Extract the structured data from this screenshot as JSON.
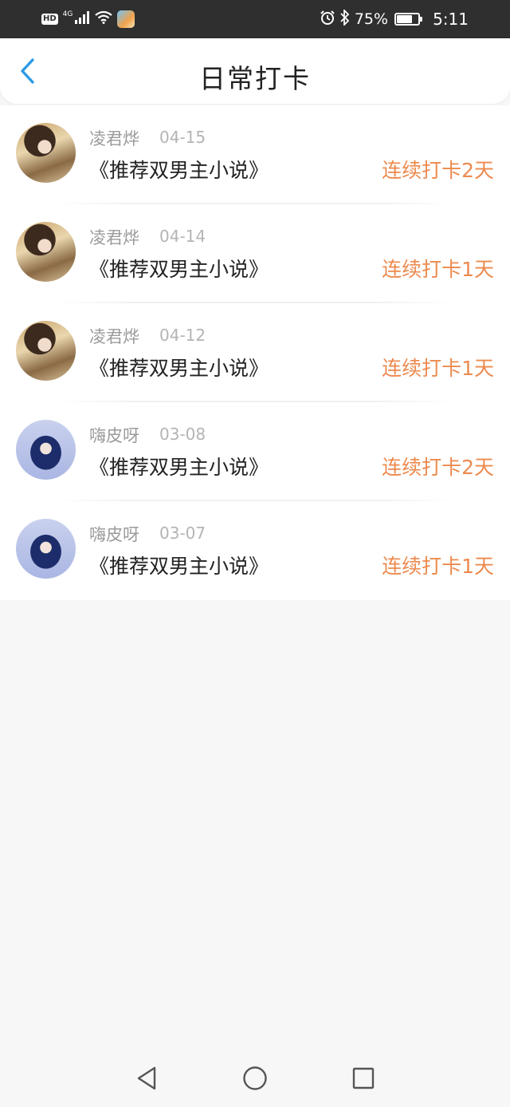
{
  "status_bar": {
    "hd_label": "HD",
    "network_label": "4G",
    "battery_percent": "75%",
    "battery_level": 0.75,
    "time": "5:11",
    "icons": [
      "hd-icon",
      "cellular-signal-icon",
      "wifi-icon",
      "app-notification-icon",
      "alarm-icon",
      "bluetooth-icon",
      "battery-icon"
    ]
  },
  "header": {
    "title": "日常打卡",
    "back_icon": "chevron-left-icon",
    "accent_color": "#2d9be6"
  },
  "entries": [
    {
      "name": "凌君烨",
      "date": "04-15",
      "book": "《推荐双男主小说》",
      "streak": "连续打卡2天",
      "avatar": "avatar-a"
    },
    {
      "name": "凌君烨",
      "date": "04-14",
      "book": "《推荐双男主小说》",
      "streak": "连续打卡1天",
      "avatar": "avatar-a"
    },
    {
      "name": "凌君烨",
      "date": "04-12",
      "book": "《推荐双男主小说》",
      "streak": "连续打卡1天",
      "avatar": "avatar-a"
    },
    {
      "name": "嗨皮呀",
      "date": "03-08",
      "book": "《推荐双男主小说》",
      "streak": "连续打卡2天",
      "avatar": "avatar-b"
    },
    {
      "name": "嗨皮呀",
      "date": "03-07",
      "book": "《推荐双男主小说》",
      "streak": "连续打卡1天",
      "avatar": "avatar-b"
    }
  ],
  "colors": {
    "streak": "#ec8a4e",
    "name": "#9b9b9b",
    "title": "#222222",
    "background": "#f8f7f8"
  },
  "nav_bar": {
    "icons": [
      "back-triangle-icon",
      "home-circle-icon",
      "recents-square-icon"
    ]
  }
}
